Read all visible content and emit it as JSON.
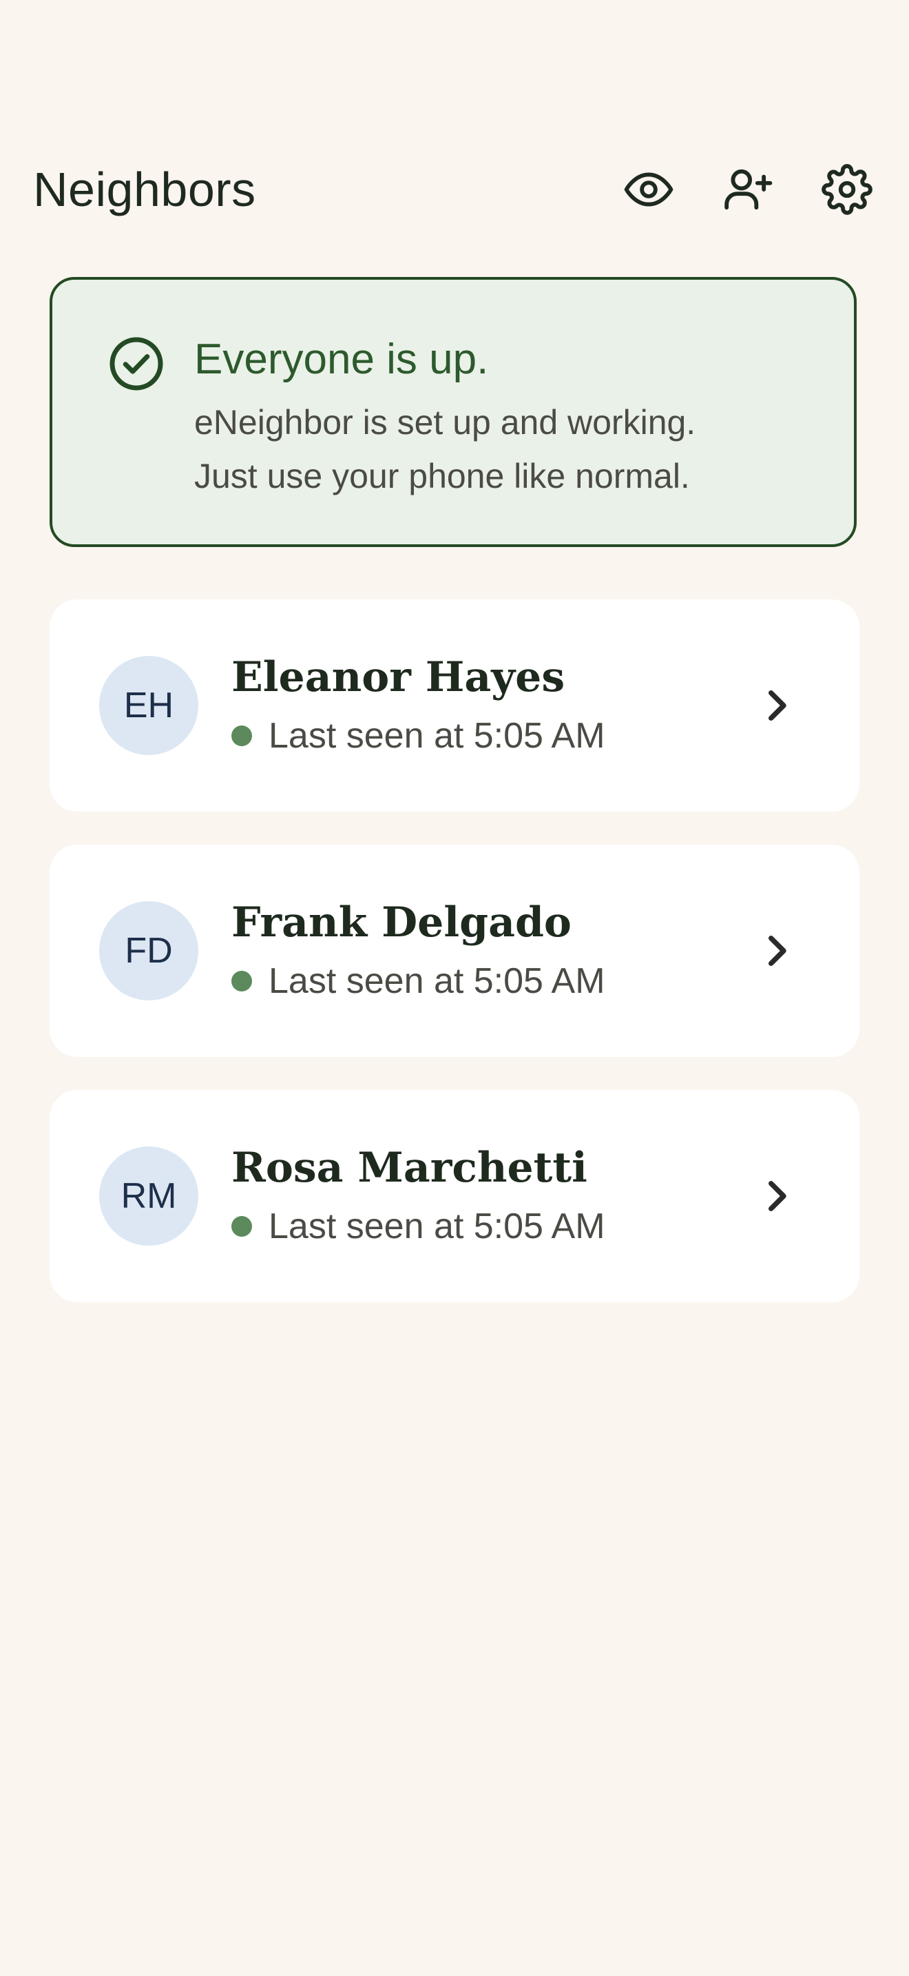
{
  "header": {
    "title": "Neighbors",
    "icons": [
      "eye-icon",
      "add-person-icon",
      "gear-icon"
    ]
  },
  "status": {
    "icon": "check-circle-icon",
    "title": "Everyone is up.",
    "line1": "eNeighbor is set up and working.",
    "line2": "Just use your phone like normal."
  },
  "neighbors": [
    {
      "initials": "EH",
      "name": "Eleanor Hayes",
      "last_seen": "Last seen at 5:05 AM"
    },
    {
      "initials": "FD",
      "name": "Frank Delgado",
      "last_seen": "Last seen at 5:05 AM"
    },
    {
      "initials": "RM",
      "name": "Rosa Marchetti",
      "last_seen": "Last seen at 5:05 AM"
    }
  ],
  "colors": {
    "background": "#FAF5EF",
    "status_green": "#2D5A2D",
    "status_border": "#244A24",
    "status_bg": "#EAF1E8",
    "online_dot": "#5C8A5C",
    "avatar_bg": "#DCE7F3"
  }
}
